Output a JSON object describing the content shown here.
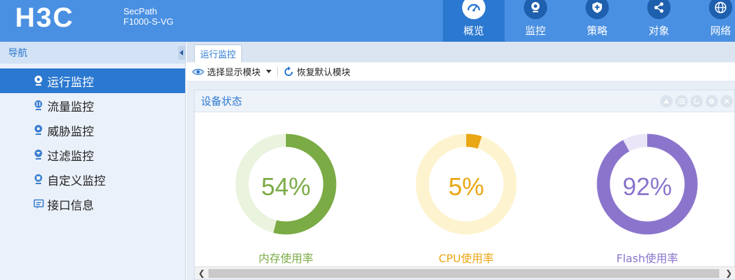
{
  "brand": {
    "logo": "H3C",
    "model_line1": "SecPath",
    "model_line2": "F1000-S-VG"
  },
  "topnav": [
    {
      "label": "概览",
      "icon": "dashboard-icon",
      "active": true
    },
    {
      "label": "监控",
      "icon": "camera-icon",
      "active": false
    },
    {
      "label": "策略",
      "icon": "shield-plus-icon",
      "active": false
    },
    {
      "label": "对象",
      "icon": "share-icon",
      "active": false
    },
    {
      "label": "网络",
      "icon": "globe-icon",
      "active": false
    }
  ],
  "sidebar": {
    "title": "导航",
    "items": [
      {
        "label": "运行监控",
        "active": true
      },
      {
        "label": "流量监控",
        "active": false
      },
      {
        "label": "威胁监控",
        "active": false
      },
      {
        "label": "过滤监控",
        "active": false
      },
      {
        "label": "自定义监控",
        "active": false
      },
      {
        "label": "接口信息",
        "active": false
      }
    ]
  },
  "main": {
    "tab": "运行监控",
    "toolbar": {
      "select_modules": "选择显示模块",
      "restore_default": "恢复默认模块"
    },
    "panel": {
      "title": "设备状态",
      "gauges": [
        {
          "value": "54%",
          "percent": 54,
          "label": "内存使用率",
          "color": "#7bab45",
          "track": "#e9f3de"
        },
        {
          "value": "5%",
          "percent": 5,
          "label": "CPU使用率",
          "color": "#eaa714",
          "track": "#fdf3cf"
        },
        {
          "value": "92%",
          "percent": 92,
          "label": "Flash使用率",
          "color": "#8b75cc",
          "track": "#ebe6f7"
        }
      ]
    }
  },
  "colors": {
    "header": "#4a90e2",
    "active": "#2b78d0"
  }
}
